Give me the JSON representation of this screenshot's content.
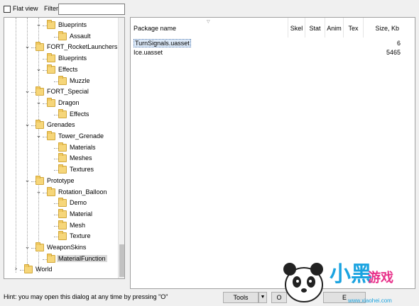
{
  "toolbar": {
    "flat_view_label": "Flat view",
    "filter_label": "Filter:",
    "filter_value": ""
  },
  "tree": {
    "nodes": [
      {
        "label": "Blueprints",
        "level": 2,
        "expander": "expanded"
      },
      {
        "label": "Assault",
        "level": 3,
        "expander": "none"
      },
      {
        "label": "FORT_RocketLaunchers",
        "level": 1,
        "expander": "expanded"
      },
      {
        "label": "Blueprints",
        "level": 2,
        "expander": "none"
      },
      {
        "label": "Effects",
        "level": 2,
        "expander": "expanded"
      },
      {
        "label": "Muzzle",
        "level": 3,
        "expander": "none"
      },
      {
        "label": "FORT_Special",
        "level": 1,
        "expander": "expanded"
      },
      {
        "label": "Dragon",
        "level": 2,
        "expander": "expanded"
      },
      {
        "label": "Effects",
        "level": 3,
        "expander": "none"
      },
      {
        "label": "Grenades",
        "level": 1,
        "expander": "expanded"
      },
      {
        "label": "Tower_Grenade",
        "level": 2,
        "expander": "expanded"
      },
      {
        "label": "Materials",
        "level": 3,
        "expander": "none"
      },
      {
        "label": "Meshes",
        "level": 3,
        "expander": "none"
      },
      {
        "label": "Textures",
        "level": 3,
        "expander": "none"
      },
      {
        "label": "Prototype",
        "level": 1,
        "expander": "expanded"
      },
      {
        "label": "Rotation_Balloon",
        "level": 2,
        "expander": "expanded"
      },
      {
        "label": "Demo",
        "level": 3,
        "expander": "none"
      },
      {
        "label": "Material",
        "level": 3,
        "expander": "none"
      },
      {
        "label": "Mesh",
        "level": 3,
        "expander": "none"
      },
      {
        "label": "Texture",
        "level": 3,
        "expander": "none"
      },
      {
        "label": "WeaponSkins",
        "level": 1,
        "expander": "expanded"
      },
      {
        "label": "MaterialFunction",
        "level": 2,
        "expander": "none",
        "selected": true
      },
      {
        "label": "World",
        "level": 0,
        "expander": "collapsed"
      }
    ]
  },
  "list": {
    "columns": [
      "Package name",
      "Skel",
      "Stat",
      "Anim",
      "Tex",
      "Size, Kb"
    ],
    "rows": [
      {
        "name": "TurnSignals.uasset",
        "skel": "",
        "stat": "",
        "anim": "",
        "tex": "",
        "size": "6",
        "selected": true
      },
      {
        "name": "Ice.uasset",
        "skel": "",
        "stat": "",
        "anim": "",
        "tex": "",
        "size": "5465"
      }
    ]
  },
  "footer": {
    "hint": "Hint: you may open this dialog at any time by pressing \"O\"",
    "tools_label": "Tools",
    "dropdown_arrow": "▼",
    "ok_label": "O",
    "more_label": "E"
  },
  "watermark": {
    "text_main": "小黑",
    "text_sub": "游戏",
    "url": "www.xiaohei.com"
  },
  "colors": {
    "folder": "#f6d67a",
    "selection": "#dce9f8",
    "logo_blue": "#1aa3e0",
    "logo_pink": "#e8318a"
  }
}
